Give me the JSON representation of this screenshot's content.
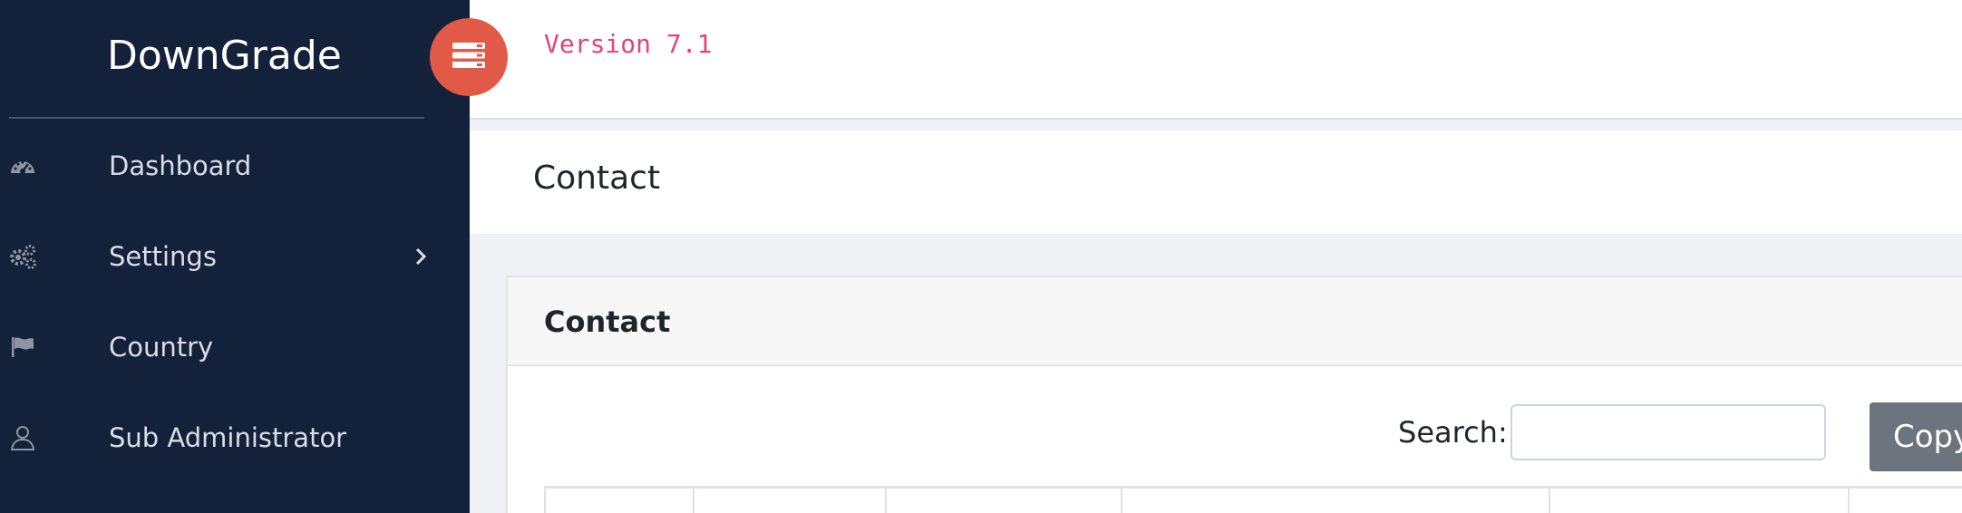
{
  "sidebar": {
    "brand": "DownGrade",
    "items": [
      {
        "label": "Dashboard",
        "icon": "dashboard-icon"
      },
      {
        "label": "Settings",
        "icon": "gears-icon",
        "has_submenu": true
      },
      {
        "label": "Country",
        "icon": "flag-icon"
      },
      {
        "label": "Sub Administrator",
        "icon": "user-icon"
      }
    ]
  },
  "topbar": {
    "toggle_icon": "menu-toggle-icon",
    "version": "Version 7.1"
  },
  "page": {
    "title": "Contact"
  },
  "card": {
    "title": "Contact",
    "search_label": "Search:",
    "search_value": "",
    "copy_label": "Copy"
  },
  "colors": {
    "sidebar_bg": "#13213a",
    "toggle_bg": "#e05a47",
    "version_text": "#e0457b",
    "copy_button": "#6c757d"
  }
}
